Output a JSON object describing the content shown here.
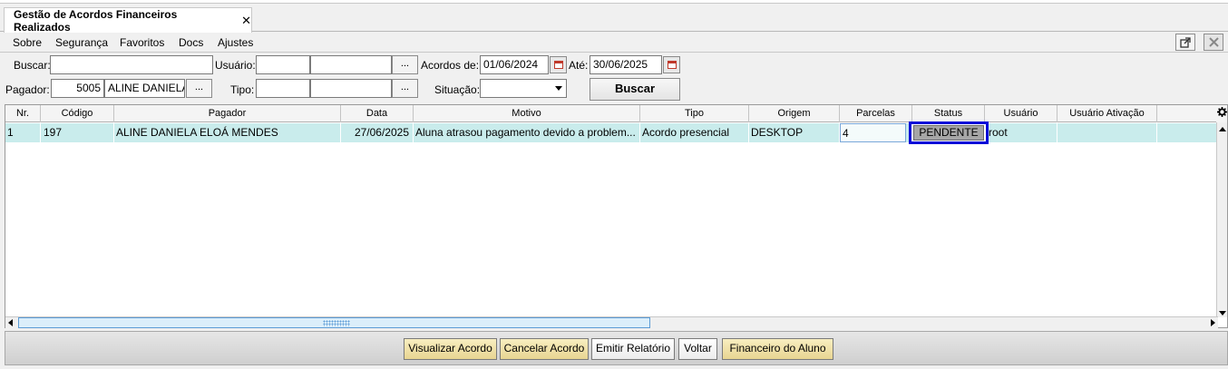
{
  "tab": {
    "title": "Gestão de Acordos Financeiros Realizados",
    "close_glyph": "✕"
  },
  "menu": [
    "Sobre",
    "Segurança",
    "Favoritos",
    "Docs",
    "Ajustes"
  ],
  "window_buttons": {
    "detach_icon": "external-link-icon",
    "close_icon": "close-icon"
  },
  "filters": {
    "buscar_label": "Buscar:",
    "buscar_value": "",
    "usuario_label": "Usuário:",
    "usuario_code": "",
    "usuario_name": "",
    "acordos_de_label": "Acordos de:",
    "acordos_de_value": "01/06/2024",
    "ate_label": "Até:",
    "ate_value": "30/06/2025",
    "pagador_label": "Pagador:",
    "pagador_code": "5005",
    "pagador_name": "ALINE DANIELA",
    "tipo_label": "Tipo:",
    "tipo_code": "",
    "tipo_name": "",
    "situacao_label": "Situação:",
    "situacao_value": "",
    "lookup_label": "...",
    "buscar_button": "Buscar"
  },
  "grid": {
    "columns": [
      "Nr.",
      "Código",
      "Pagador",
      "Data",
      "Motivo",
      "Tipo",
      "Origem",
      "Parcelas",
      "Status",
      "Usuário",
      "Usuário Ativação"
    ],
    "rows": [
      {
        "nr": "1",
        "codigo": "197",
        "pagador": "ALINE DANIELA ELOÁ MENDES",
        "data": "27/06/2025",
        "motivo": "Aluna atrasou pagamento devido a problem...",
        "tipo": "Acordo presencial",
        "origem": "DESKTOP",
        "parcelas": "4",
        "status": "PENDENTE",
        "usuario": "root",
        "usuario_ativacao": ""
      }
    ],
    "accent_color": "#c9ecec",
    "selection_color": "#0a0ad8"
  },
  "actions": {
    "visualizar": "Visualizar Acordo",
    "cancelar": "Cancelar Acordo",
    "emitir": "Emitir Relatório",
    "voltar": "Voltar",
    "financeiro": "Financeiro do Aluno"
  }
}
